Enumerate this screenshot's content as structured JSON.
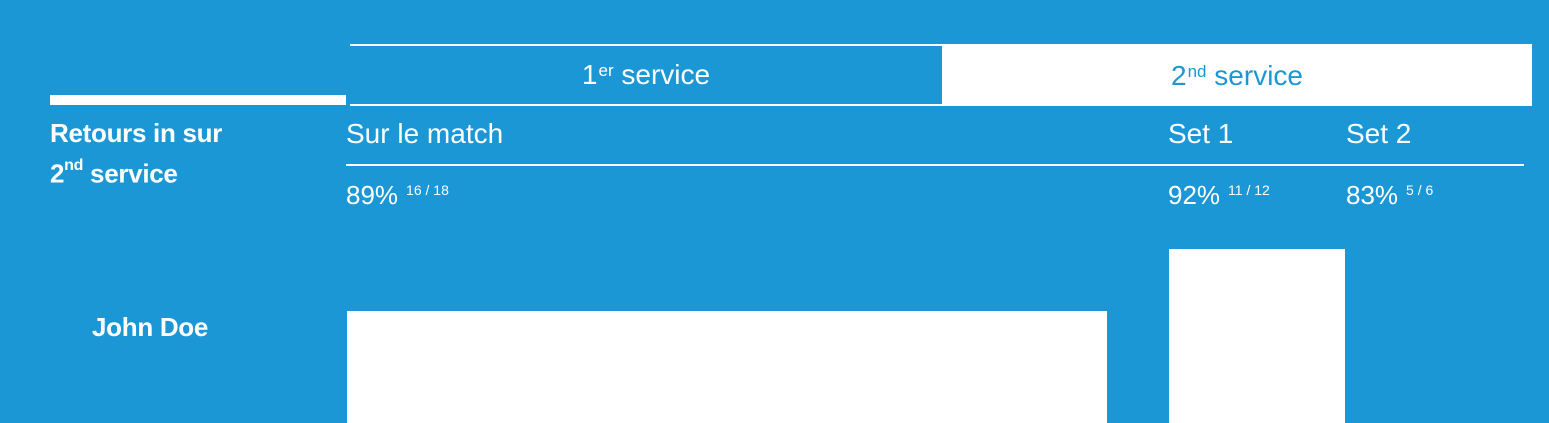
{
  "tabs": [
    {
      "label_main": "1",
      "label_sup": "er",
      "label_rest": " service",
      "active": false
    },
    {
      "label_main": "2",
      "label_sup": "nd",
      "label_rest": " service",
      "active": true
    }
  ],
  "heading": {
    "line1": "Retours in sur",
    "line2_main": "2",
    "line2_sup": "nd",
    "line2_rest": " service"
  },
  "columns": {
    "match": "Sur le match",
    "set1": "Set 1",
    "set2": "Set 2"
  },
  "stats": {
    "match": {
      "pct": "89%",
      "frac": "16 / 18",
      "ratio": 0.89
    },
    "set1": {
      "pct": "92%",
      "frac": "11 / 12",
      "ratio": 0.92
    },
    "set2": {
      "pct": "83%",
      "frac": "5 / 6",
      "ratio": 0.83
    }
  },
  "player": {
    "name": "John Doe"
  },
  "colors": {
    "background": "#1b97d6",
    "foreground": "#ffffff"
  }
}
